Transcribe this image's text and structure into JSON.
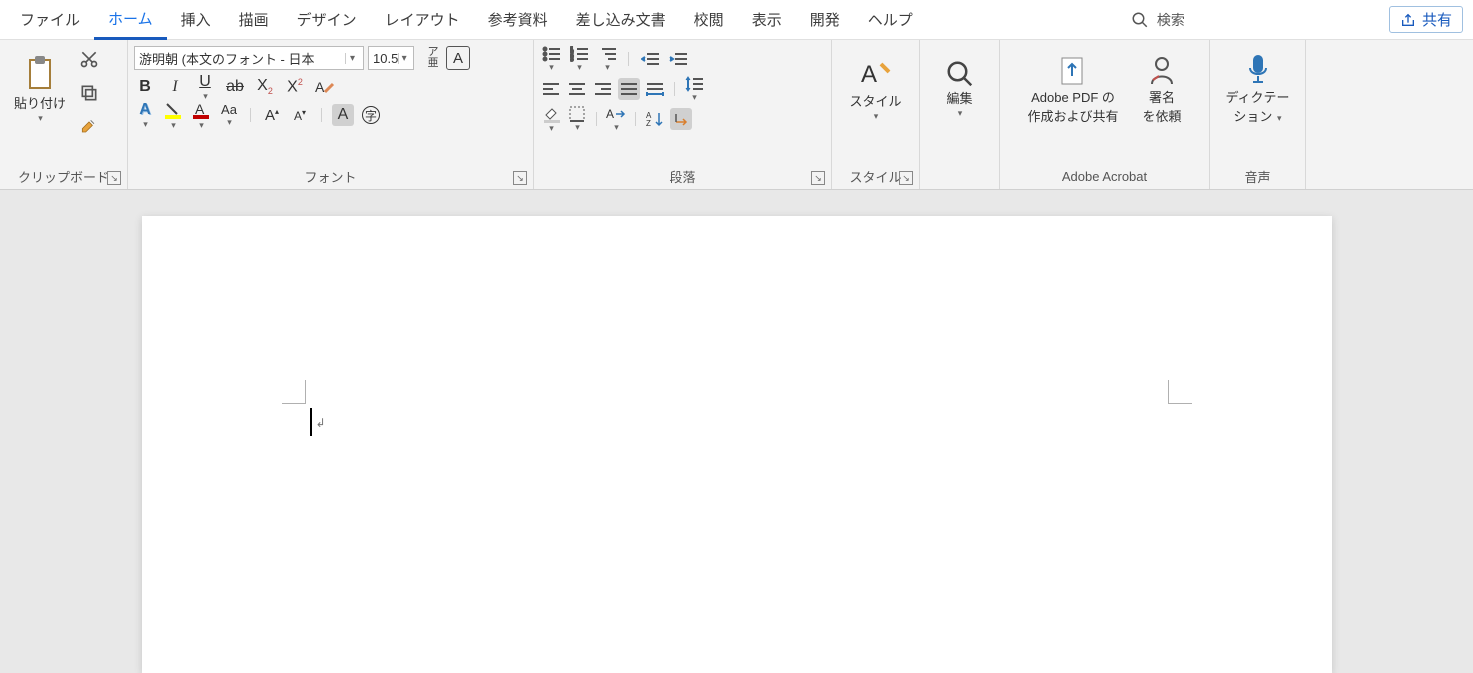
{
  "tabs": {
    "file": "ファイル",
    "home": "ホーム",
    "insert": "挿入",
    "draw": "描画",
    "design": "デザイン",
    "layout": "レイアウト",
    "references": "参考資料",
    "mailings": "差し込み文書",
    "review": "校閲",
    "view": "表示",
    "developer": "開発",
    "help": "ヘルプ",
    "search": "検索",
    "share": "共有"
  },
  "ribbon": {
    "clipboard": {
      "label": "クリップボード",
      "paste": "貼り付け"
    },
    "font": {
      "label": "フォント",
      "name": "游明朝 (本文のフォント - 日本",
      "size": "10.5"
    },
    "paragraph": {
      "label": "段落"
    },
    "styles": {
      "label": "スタイル",
      "btn": "スタイル"
    },
    "editing": {
      "label": "",
      "btn": "編集"
    },
    "acrobat": {
      "label": "Adobe Acrobat",
      "pdf1": "Adobe PDF の",
      "pdf2": "作成および共有",
      "sign1": "署名",
      "sign2": "を依頼"
    },
    "voice": {
      "label": "音声",
      "dictate1": "ディクテー",
      "dictate2": "ション"
    }
  }
}
